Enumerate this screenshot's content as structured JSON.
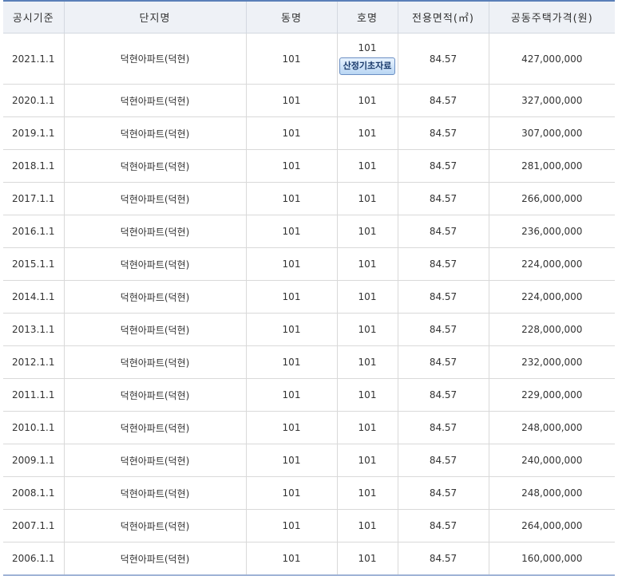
{
  "table": {
    "headers": [
      "공시기준",
      "단지명",
      "동명",
      "호명",
      "전용면적(㎡)",
      "공동주택가격(원)"
    ],
    "calc_button_label": "산정기초자료",
    "rows": [
      {
        "date": "2021.1.1",
        "complex": "덕현아파트(덕현)",
        "dong": "101",
        "ho": "101",
        "area": "84.57",
        "price": "427,000,000"
      },
      {
        "date": "2020.1.1",
        "complex": "덕현아파트(덕현)",
        "dong": "101",
        "ho": "101",
        "area": "84.57",
        "price": "327,000,000"
      },
      {
        "date": "2019.1.1",
        "complex": "덕현아파트(덕현)",
        "dong": "101",
        "ho": "101",
        "area": "84.57",
        "price": "307,000,000"
      },
      {
        "date": "2018.1.1",
        "complex": "덕현아파트(덕현)",
        "dong": "101",
        "ho": "101",
        "area": "84.57",
        "price": "281,000,000"
      },
      {
        "date": "2017.1.1",
        "complex": "덕현아파트(덕현)",
        "dong": "101",
        "ho": "101",
        "area": "84.57",
        "price": "266,000,000"
      },
      {
        "date": "2016.1.1",
        "complex": "덕현아파트(덕현)",
        "dong": "101",
        "ho": "101",
        "area": "84.57",
        "price": "236,000,000"
      },
      {
        "date": "2015.1.1",
        "complex": "덕현아파트(덕현)",
        "dong": "101",
        "ho": "101",
        "area": "84.57",
        "price": "224,000,000"
      },
      {
        "date": "2014.1.1",
        "complex": "덕현아파트(덕현)",
        "dong": "101",
        "ho": "101",
        "area": "84.57",
        "price": "224,000,000"
      },
      {
        "date": "2013.1.1",
        "complex": "덕현아파트(덕현)",
        "dong": "101",
        "ho": "101",
        "area": "84.57",
        "price": "228,000,000"
      },
      {
        "date": "2012.1.1",
        "complex": "덕현아파트(덕현)",
        "dong": "101",
        "ho": "101",
        "area": "84.57",
        "price": "232,000,000"
      },
      {
        "date": "2011.1.1",
        "complex": "덕현아파트(덕현)",
        "dong": "101",
        "ho": "101",
        "area": "84.57",
        "price": "229,000,000"
      },
      {
        "date": "2010.1.1",
        "complex": "덕현아파트(덕현)",
        "dong": "101",
        "ho": "101",
        "area": "84.57",
        "price": "248,000,000"
      },
      {
        "date": "2009.1.1",
        "complex": "덕현아파트(덕현)",
        "dong": "101",
        "ho": "101",
        "area": "84.57",
        "price": "240,000,000"
      },
      {
        "date": "2008.1.1",
        "complex": "덕현아파트(덕현)",
        "dong": "101",
        "ho": "101",
        "area": "84.57",
        "price": "248,000,000"
      },
      {
        "date": "2007.1.1",
        "complex": "덕현아파트(덕현)",
        "dong": "101",
        "ho": "101",
        "area": "84.57",
        "price": "264,000,000"
      },
      {
        "date": "2006.1.1",
        "complex": "덕현아파트(덕현)",
        "dong": "101",
        "ho": "101",
        "area": "84.57",
        "price": "160,000,000"
      }
    ]
  },
  "colors": {
    "header_bg": "#eef1f6",
    "top_border": "#5a7fb8",
    "button_text": "#1a3a6b"
  }
}
